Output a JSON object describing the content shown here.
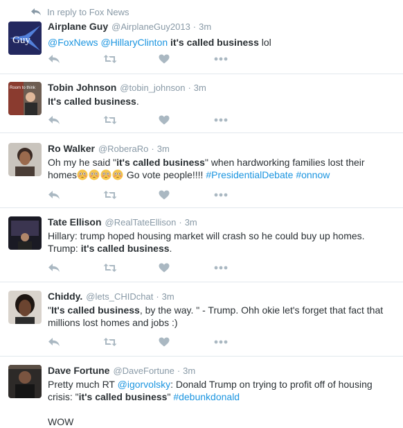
{
  "reply_context": {
    "text": "In reply to Fox News"
  },
  "tweets": [
    {
      "fullname": "Airplane Guy",
      "username": "@AirplaneGuy2013",
      "time": "3m",
      "avatar_text": "Guy",
      "segments": [
        {
          "t": "@FoxNews",
          "s": "link"
        },
        {
          "t": " "
        },
        {
          "t": "@HillaryClinton",
          "s": "link"
        },
        {
          "t": " "
        },
        {
          "t": "it's called business",
          "s": "bold"
        },
        {
          "t": " lol"
        }
      ]
    },
    {
      "fullname": "Tobin Johnson",
      "username": "@tobin_johnson",
      "time": "3m",
      "avatar_text": "Room to think",
      "segments": [
        {
          "t": "It's called business",
          "s": "bold"
        },
        {
          "t": "."
        }
      ]
    },
    {
      "fullname": "Ro Walker",
      "username": "@RoberaRo",
      "time": "3m",
      "segments": [
        {
          "t": "Oh my he said \""
        },
        {
          "t": "it's called business",
          "s": "bold"
        },
        {
          "t": "\" when hardworking families lost their homes"
        },
        {
          "t": "flushed-face",
          "s": "emoji"
        },
        {
          "t": "flushed-face",
          "s": "emoji"
        },
        {
          "t": "flushed-face",
          "s": "emoji"
        },
        {
          "t": "flushed-face",
          "s": "emoji"
        },
        {
          "t": " Go vote people!!!! "
        },
        {
          "t": "#PresidentialDebate",
          "s": "link"
        },
        {
          "t": " "
        },
        {
          "t": "#onnow",
          "s": "link"
        }
      ]
    },
    {
      "fullname": "Tate Ellison",
      "username": "@RealTateEllison",
      "time": "3m",
      "segments": [
        {
          "t": "Hillary: trump hoped housing market will crash so he could buy up homes. Trump: "
        },
        {
          "t": "it's called business",
          "s": "bold"
        },
        {
          "t": "."
        }
      ]
    },
    {
      "fullname": "Chiddy.",
      "username": "@lets_CHIDchat",
      "time": "3m",
      "segments": [
        {
          "t": "\""
        },
        {
          "t": "It's called business",
          "s": "bold"
        },
        {
          "t": ", by the way. \" - Trump. Ohh okie let's forget that fact that millions lost homes and jobs :)"
        }
      ]
    },
    {
      "fullname": "Dave Fortune",
      "username": "@DaveFortune",
      "time": "3m",
      "segments": [
        {
          "t": "Pretty much RT "
        },
        {
          "t": "@igorvolsky",
          "s": "link"
        },
        {
          "t": ": Donald Trump on trying to profit off of housing crisis: \""
        },
        {
          "t": "it's called business",
          "s": "bold"
        },
        {
          "t": "\" "
        },
        {
          "t": "#debunkdonald",
          "s": "link"
        }
      ],
      "extra_line": "WOW"
    }
  ],
  "colors": {
    "link": "#1b95e0",
    "meta": "#8899a6",
    "text": "#292f33",
    "icon": "#aab8c2",
    "divider": "#e1e8ed"
  },
  "icons": {
    "reply": "reply-icon",
    "retweet": "retweet-icon",
    "like": "heart-icon",
    "more": "more-icon",
    "context": "reply-arrow-icon"
  }
}
